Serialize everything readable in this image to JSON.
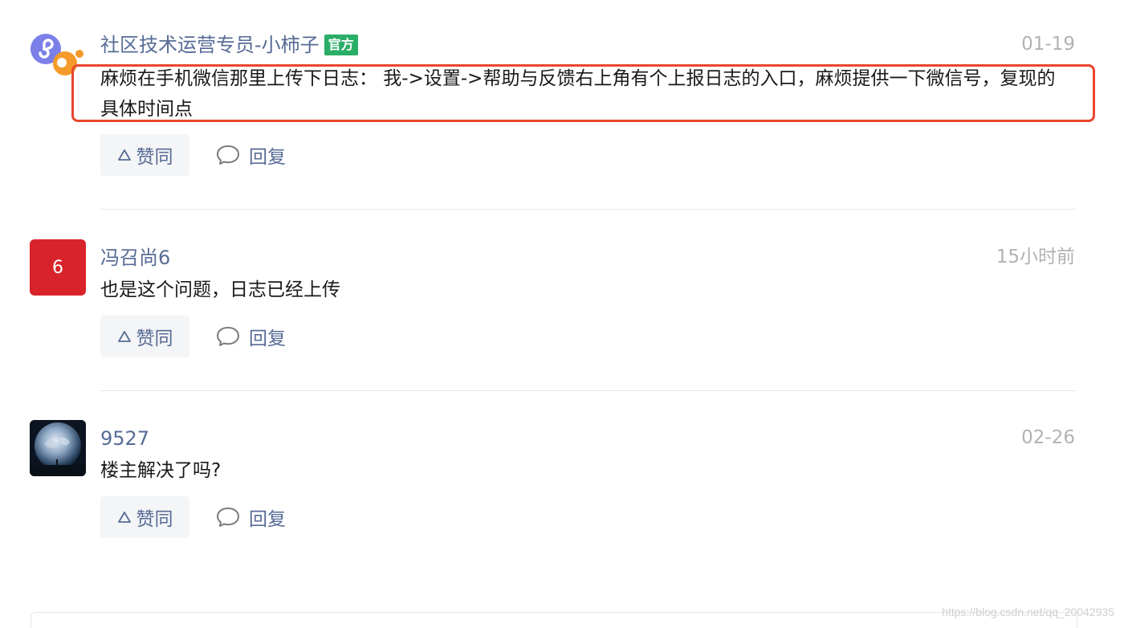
{
  "comments": [
    {
      "author": "社区技术运营专员-小柿子",
      "badge": "官方",
      "time": "01-19",
      "content": "麻烦在手机微信那里上传下日志： 我->设置->帮助与反馈右上角有个上报日志的入口，麻烦提供一下微信号，复现的具体时间点",
      "like_label": "赞同",
      "reply_label": "回复",
      "avatar_type": "miniprogram-logo"
    },
    {
      "author": "冯召尚6",
      "time": "15小时前",
      "content": "也是这个问题，日志已经上传",
      "like_label": "赞同",
      "reply_label": "回复",
      "avatar_text": "6",
      "avatar_color": "#d8232a"
    },
    {
      "author": "9527",
      "time": "02-26",
      "content": "楼主解决了吗?",
      "like_label": "赞同",
      "reply_label": "回复",
      "avatar_type": "earth-photo"
    }
  ],
  "watermark": "https://blog.csdn.net/qq_20042935",
  "colors": {
    "author": "#576b95",
    "badge": "#2aae67",
    "highlight": "#e9462f",
    "time": "#b2b2b2"
  }
}
